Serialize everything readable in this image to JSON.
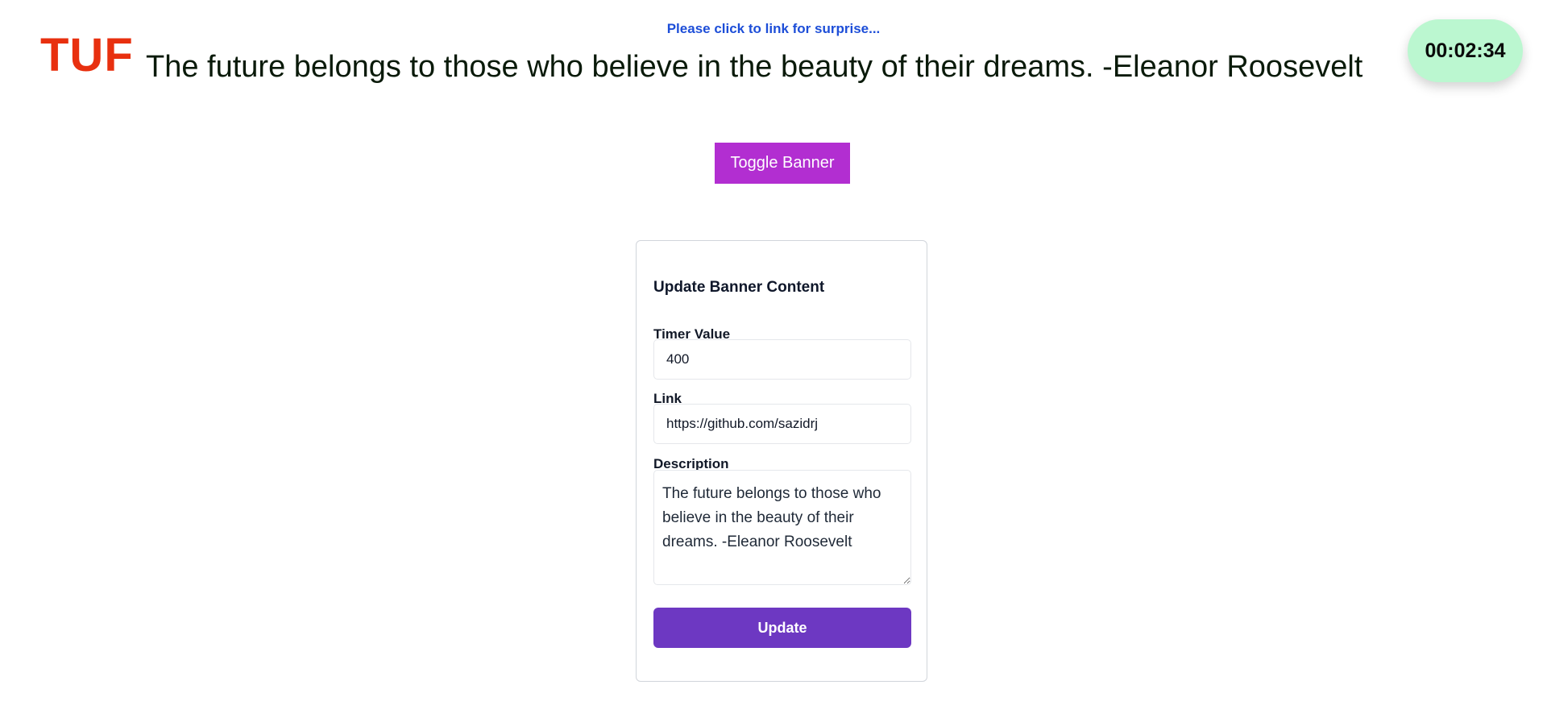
{
  "banner": {
    "logo": "TUF",
    "link_text": "Please click to link for surprise...",
    "quote": "The future belongs to those who believe in the beauty of their dreams. -Eleanor Roosevelt",
    "timer": "00:02:34"
  },
  "toggle": {
    "label": "Toggle Banner"
  },
  "form": {
    "title": "Update Banner Content",
    "timer_label": "Timer Value",
    "timer_value": "400",
    "link_label": "Link",
    "link_value": "https://github.com/sazidrj",
    "description_label": "Description",
    "description_value": "The future belongs to those who believe in the beauty of their dreams. -Eleanor Roosevelt",
    "submit_label": "Update"
  },
  "colors": {
    "logo": "#e8300f",
    "link": "#1d4ed8",
    "timer_bg": "#bbf7d0",
    "toggle_bg": "#b22ed1",
    "update_bg": "#6d38c2"
  }
}
